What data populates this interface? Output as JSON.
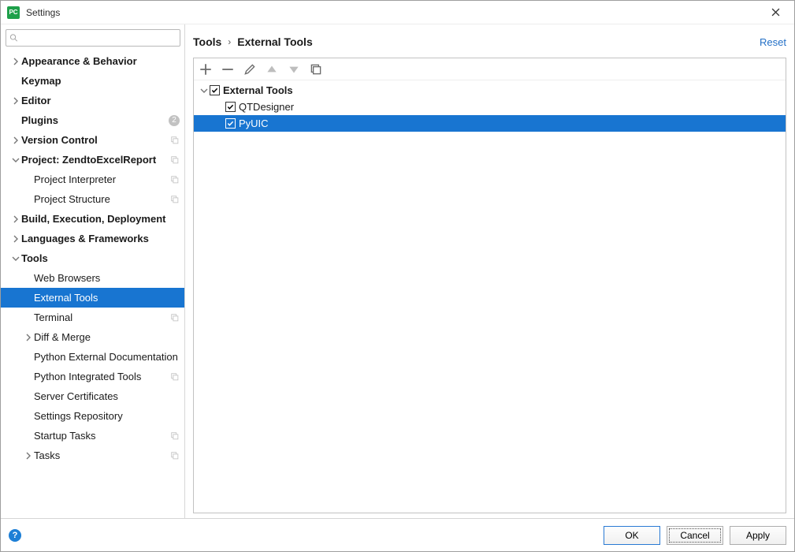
{
  "window": {
    "title": "Settings",
    "icon_text": "PC"
  },
  "search": {
    "placeholder": ""
  },
  "sidebar": {
    "items": [
      {
        "label": "Appearance & Behavior",
        "level": 0,
        "bold": true,
        "arrow": "right",
        "badge": null,
        "copy": false
      },
      {
        "label": "Keymap",
        "level": 0,
        "bold": true,
        "arrow": "none",
        "badge": null,
        "copy": false
      },
      {
        "label": "Editor",
        "level": 0,
        "bold": true,
        "arrow": "right",
        "badge": null,
        "copy": false
      },
      {
        "label": "Plugins",
        "level": 0,
        "bold": true,
        "arrow": "none",
        "badge": "2",
        "copy": false
      },
      {
        "label": "Version Control",
        "level": 0,
        "bold": true,
        "arrow": "right",
        "badge": null,
        "copy": true
      },
      {
        "label": "Project: ZendtoExcelReport",
        "level": 0,
        "bold": true,
        "arrow": "down",
        "badge": null,
        "copy": true
      },
      {
        "label": "Project Interpreter",
        "level": 1,
        "bold": false,
        "arrow": "none",
        "badge": null,
        "copy": true
      },
      {
        "label": "Project Structure",
        "level": 1,
        "bold": false,
        "arrow": "none",
        "badge": null,
        "copy": true
      },
      {
        "label": "Build, Execution, Deployment",
        "level": 0,
        "bold": true,
        "arrow": "right",
        "badge": null,
        "copy": false
      },
      {
        "label": "Languages & Frameworks",
        "level": 0,
        "bold": true,
        "arrow": "right",
        "badge": null,
        "copy": false
      },
      {
        "label": "Tools",
        "level": 0,
        "bold": true,
        "arrow": "down",
        "badge": null,
        "copy": false
      },
      {
        "label": "Web Browsers",
        "level": 1,
        "bold": false,
        "arrow": "none",
        "badge": null,
        "copy": false
      },
      {
        "label": "External Tools",
        "level": 1,
        "bold": false,
        "arrow": "none",
        "badge": null,
        "copy": false,
        "selected": true
      },
      {
        "label": "Terminal",
        "level": 1,
        "bold": false,
        "arrow": "none",
        "badge": null,
        "copy": true
      },
      {
        "label": "Diff & Merge",
        "level": 1,
        "bold": false,
        "arrow": "right",
        "badge": null,
        "copy": false
      },
      {
        "label": "Python External Documentation",
        "level": 1,
        "bold": false,
        "arrow": "none",
        "badge": null,
        "copy": false
      },
      {
        "label": "Python Integrated Tools",
        "level": 1,
        "bold": false,
        "arrow": "none",
        "badge": null,
        "copy": true
      },
      {
        "label": "Server Certificates",
        "level": 1,
        "bold": false,
        "arrow": "none",
        "badge": null,
        "copy": false
      },
      {
        "label": "Settings Repository",
        "level": 1,
        "bold": false,
        "arrow": "none",
        "badge": null,
        "copy": false
      },
      {
        "label": "Startup Tasks",
        "level": 1,
        "bold": false,
        "arrow": "none",
        "badge": null,
        "copy": true
      },
      {
        "label": "Tasks",
        "level": 1,
        "bold": false,
        "arrow": "right",
        "badge": null,
        "copy": true
      }
    ]
  },
  "breadcrumb": {
    "parts": [
      "Tools",
      "External Tools"
    ],
    "reset": "Reset"
  },
  "external_tools": {
    "group": "External Tools",
    "items": [
      {
        "label": "QTDesigner",
        "checked": true,
        "selected": false
      },
      {
        "label": "PyUIC",
        "checked": true,
        "selected": true
      }
    ]
  },
  "footer": {
    "ok": "OK",
    "cancel": "Cancel",
    "apply": "Apply",
    "help": "?"
  }
}
